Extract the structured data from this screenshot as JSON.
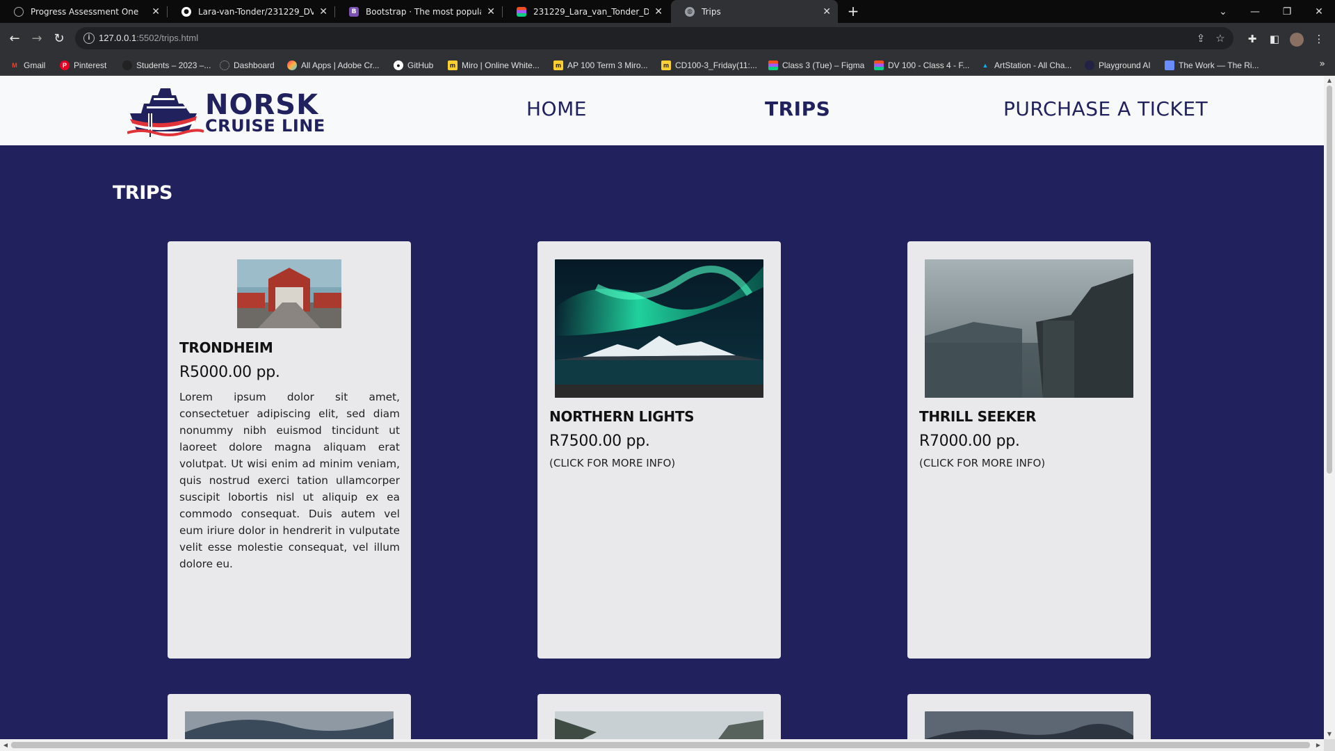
{
  "browser": {
    "tabs": [
      {
        "label": "Progress Assessment One",
        "icon": "loading-circle-icon"
      },
      {
        "label": "Lara-van-Tonder/231229_DV100_",
        "icon": "github-icon"
      },
      {
        "label": "Bootstrap · The most popular HT",
        "icon": "bootstrap-icon"
      },
      {
        "label": "231229_Lara_van_Tonder_DV100_",
        "icon": "figma-icon"
      },
      {
        "label": "Trips",
        "icon": "globe-icon"
      }
    ],
    "url_host": "127.0.0.1",
    "url_rest": ":5502/trips.html",
    "bookmarks": [
      {
        "label": "Gmail",
        "color": "#ea4335"
      },
      {
        "label": "Pinterest",
        "color": "#e60023"
      },
      {
        "label": "Students – 2023 –...",
        "color": "#222222"
      },
      {
        "label": "Dashboard",
        "color": "#444444"
      },
      {
        "label": "All Apps | Adobe Cr...",
        "color": "#ff6a3d"
      },
      {
        "label": "GitHub",
        "color": "#ffffff"
      },
      {
        "label": "Miro | Online White...",
        "color": "#ffd02f"
      },
      {
        "label": "AP 100 Term 3 Miro...",
        "color": "#ffd02f"
      },
      {
        "label": "CD100-3_Friday(11:...",
        "color": "#ffd02f"
      },
      {
        "label": "Class 3 (Tue) – Figma",
        "color": "#a259ff"
      },
      {
        "label": "DV 100 - Class 4 - F...",
        "color": "#a259ff"
      },
      {
        "label": "ArtStation - All Cha...",
        "color": "#13aff0"
      },
      {
        "label": "Playground AI",
        "color": "#222244"
      },
      {
        "label": "The Work — The Ri...",
        "color": "#6b8cff"
      }
    ]
  },
  "site": {
    "logo_line1": "NORSK",
    "logo_line2": "CRUISE LINE",
    "nav": {
      "home": "HOME",
      "trips": "TRIPS",
      "purchase": "PURCHASE A TICKET"
    },
    "section_title": "TRIPS"
  },
  "cards": [
    {
      "title": "TRONDHEIM",
      "price": "R5000.00 pp.",
      "description": "Lorem ipsum dolor sit amet, consectetuer adipiscing elit, sed diam nonummy nibh euismod tincidunt ut laoreet dolore magna aliquam erat volutpat. Ut wisi enim ad minim veniam, quis nostrud exerci tation ullamcorper suscipit lobortis nisl ut aliquip ex ea commodo consequat. Duis autem vel eum iriure dolor in hendrerit in vulputate velit esse molestie consequat, vel illum dolore eu."
    },
    {
      "title": "NORTHERN LIGHTS",
      "price": "R7500.00 pp.",
      "more": "(CLICK FOR MORE INFO)"
    },
    {
      "title": "THRILL SEEKER",
      "price": "R7000.00 pp.",
      "more": "(CLICK FOR MORE INFO)"
    }
  ]
}
